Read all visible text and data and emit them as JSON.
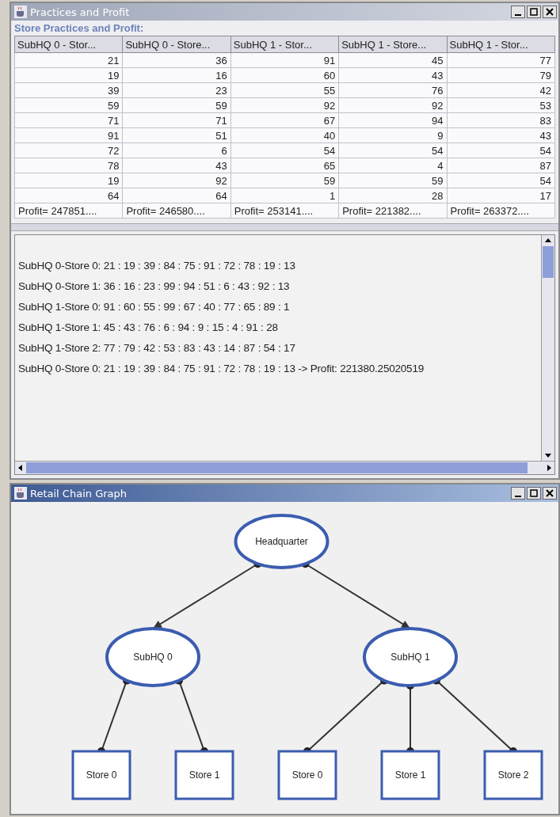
{
  "windows": [
    {
      "kind": "table",
      "title": "Practices and Profit",
      "active": false,
      "heading": "Store  Practices and Profit:",
      "table": {
        "columns": [
          "SubHQ 0 - Stor...",
          "SubHQ 0 - Store...",
          "SubHQ 1 - Stor...",
          "SubHQ 1 - Store...",
          "SubHQ 1 - Stor..."
        ],
        "rows": [
          [
            "21",
            "36",
            "91",
            "45",
            "77"
          ],
          [
            "19",
            "16",
            "60",
            "43",
            "79"
          ],
          [
            "39",
            "23",
            "55",
            "76",
            "42"
          ],
          [
            "59",
            "59",
            "92",
            "92",
            "53"
          ],
          [
            "71",
            "71",
            "67",
            "94",
            "83"
          ],
          [
            "91",
            "51",
            "40",
            "9",
            "43"
          ],
          [
            "72",
            "6",
            "54",
            "54",
            "54"
          ],
          [
            "78",
            "43",
            "65",
            "4",
            "87"
          ],
          [
            "19",
            "92",
            "59",
            "59",
            "54"
          ],
          [
            "64",
            "64",
            "1",
            "28",
            "17"
          ]
        ],
        "footer": [
          "Profit= 247851....",
          "Profit= 246580....",
          "Profit= 253141....",
          "Profit= 221382....",
          "Profit= 263372...."
        ]
      },
      "log": [
        "SubHQ 0-Store 0: 21 : 19 : 39 : 84 : 75 : 91 : 72 : 78 : 19 : 13",
        "SubHQ 0-Store 1: 36 : 16 : 23 : 99 : 94 : 51 : 6 : 43 : 92 : 13",
        "SubHQ 1-Store 0: 91 : 60 : 55 : 99 : 67 : 40 : 77 : 65 : 89 : 1",
        "SubHQ 1-Store 1: 45 : 43 : 76 : 6 : 94 : 9 : 15 : 4 : 91 : 28",
        "SubHQ 1-Store 2: 77 : 79 : 42 : 53 : 83 : 43 : 14 : 87 : 54 : 17",
        "SubHQ 0-Store 0: 21 : 19 : 39 : 84 : 75 : 91 : 72 : 78 : 19 : 13 -> Profit: 221380.25020519"
      ]
    },
    {
      "kind": "graph",
      "title": "Retail Chain Graph",
      "active": true,
      "graph": {
        "label": "Headquarter",
        "children": [
          {
            "label": "SubHQ 0",
            "children": [
              {
                "label": "Store 0"
              },
              {
                "label": "Store 1"
              }
            ]
          },
          {
            "label": "SubHQ 1",
            "children": [
              {
                "label": "Store 0"
              },
              {
                "label": "Store 1"
              },
              {
                "label": "Store 2"
              }
            ]
          }
        ]
      }
    }
  ]
}
